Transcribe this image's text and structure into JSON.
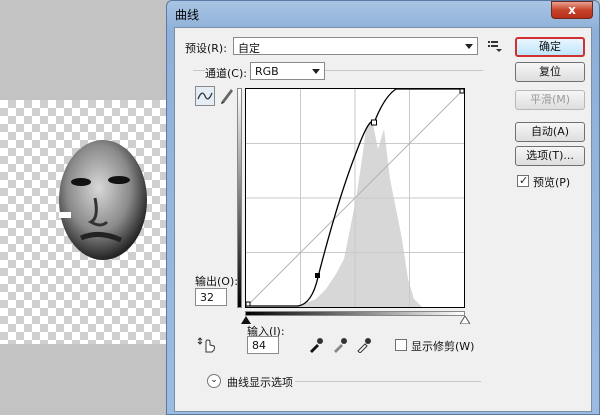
{
  "window": {
    "title": "曲线",
    "close_label": "x"
  },
  "preset": {
    "label": "预设(R):",
    "value": "自定"
  },
  "channel": {
    "label": "通道(C):",
    "value": "RGB"
  },
  "output": {
    "label": "输出(O):",
    "value": "32"
  },
  "input": {
    "label": "输入(I):",
    "value": "84"
  },
  "buttons": {
    "ok": "确定",
    "reset": "复位",
    "smooth": "平滑(M)",
    "auto": "自动(A)",
    "options": "选项(T)..."
  },
  "preview": {
    "label": "预览(P)",
    "checked": true
  },
  "show_clipping": {
    "label": "显示修剪(W)",
    "checked": false
  },
  "curve_display_options": {
    "label": "曲线显示选项"
  },
  "icons": [
    "menu-list-icon",
    "curve-point-icon",
    "pencil-icon",
    "hand-target-icon",
    "eyedropper-black-icon",
    "eyedropper-gray-icon",
    "eyedropper-white-icon",
    "expand-chevron-icon",
    "close-icon"
  ]
}
